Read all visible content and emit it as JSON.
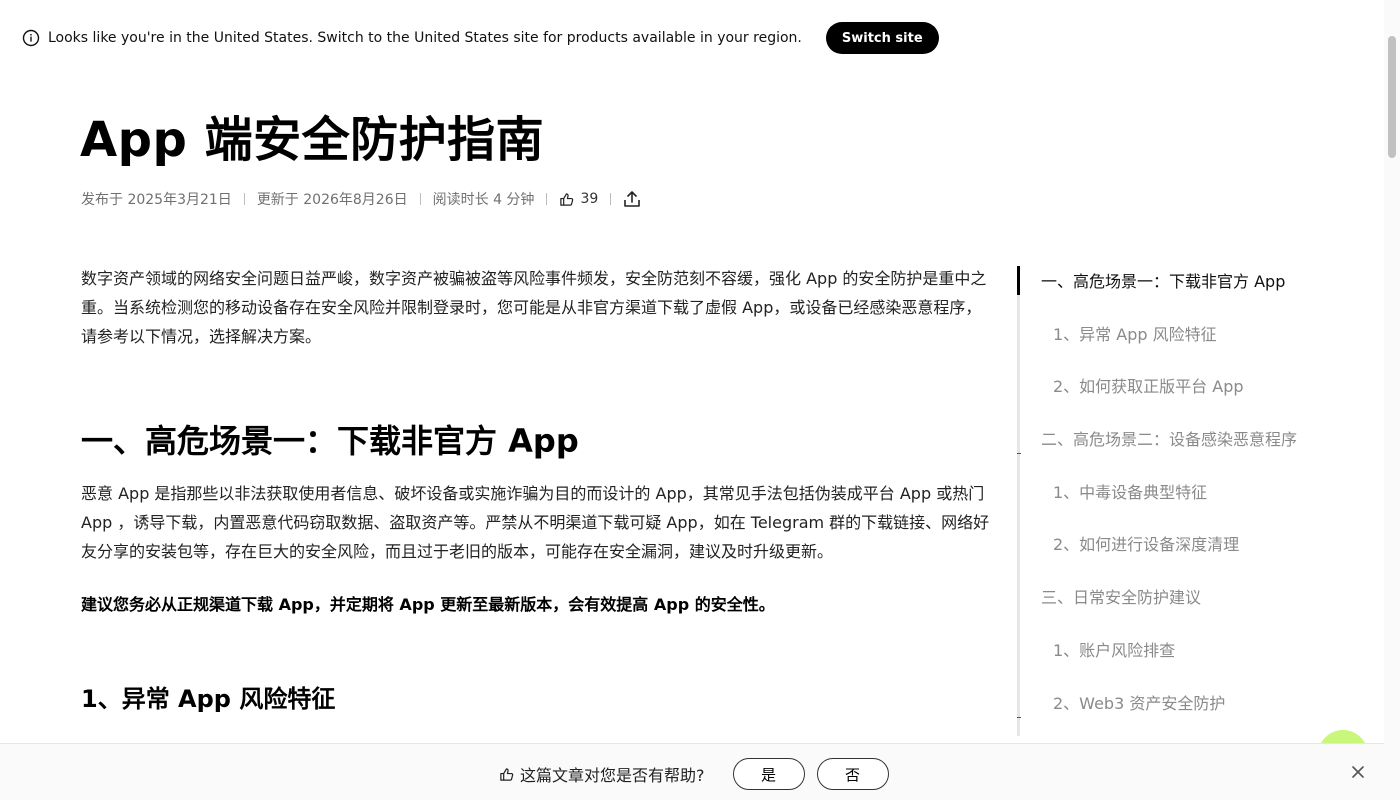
{
  "banner": {
    "message": "Looks like you're in the United States. Switch to the United States site for products available in your region.",
    "switch_label": "Switch site"
  },
  "article": {
    "title": "App 端安全防护指南",
    "meta": {
      "published": "发布于 2025年3月21日",
      "updated": "更新于 2026年8月26日",
      "read_time": "阅读时长 4 分钟",
      "likes": "39"
    },
    "intro": "数字资产领域的网络安全问题日益严峻，数字资产被骗被盗等风险事件频发，安全防范刻不容缓，强化 App 的安全防护是重中之重。当系统检测您的移动设备存在安全风险并限制登录时，您可能是从非官方渠道下载了虚假 App，或设备已经感染恶意程序，请参考以下情况，选择解决方案。",
    "section1_heading": "一、高危场景一：下载非官方 App",
    "section1_para": "恶意 App 是指那些以非法获取使用者信息、破坏设备或实施诈骗为目的而设计的 App，其常见手法包括伪装成平台 App 或热门 App ，诱导下载，内置恶意代码窃取数据、盗取资产等。严禁从不明渠道下载可疑 App，如在 Telegram 群的下载链接、网络好友分享的安装包等，存在巨大的安全风险，而且过于老旧的版本，可能存在安全漏洞，建议及时升级更新。",
    "section1_strong": "建议您务必从正规渠道下载 App，并定期将 App 更新至最新版本，会有效提高 App 的安全性。",
    "section1_sub1": "1、异常 App 风险特征"
  },
  "toc": {
    "items": [
      {
        "label": "一、高危场景一：下载非官方 App"
      },
      {
        "label": "1、异常 App 风险特征"
      },
      {
        "label": "2、如何获取正版平台 App"
      },
      {
        "label": "二、高危场景二：设备感染恶意程序"
      },
      {
        "label": "1、中毒设备典型特征"
      },
      {
        "label": "2、如何进行设备深度清理"
      },
      {
        "label": "三、日常安全防护建议"
      },
      {
        "label": "1、账户风险排查"
      },
      {
        "label": "2、Web3 资产安全防护"
      }
    ]
  },
  "feedback": {
    "question": "这篇文章对您是否有帮助?",
    "yes_label": "是",
    "no_label": "否"
  },
  "colors": {
    "accent_bubble": "#c8f77a",
    "text_muted": "#8a8a8a"
  }
}
